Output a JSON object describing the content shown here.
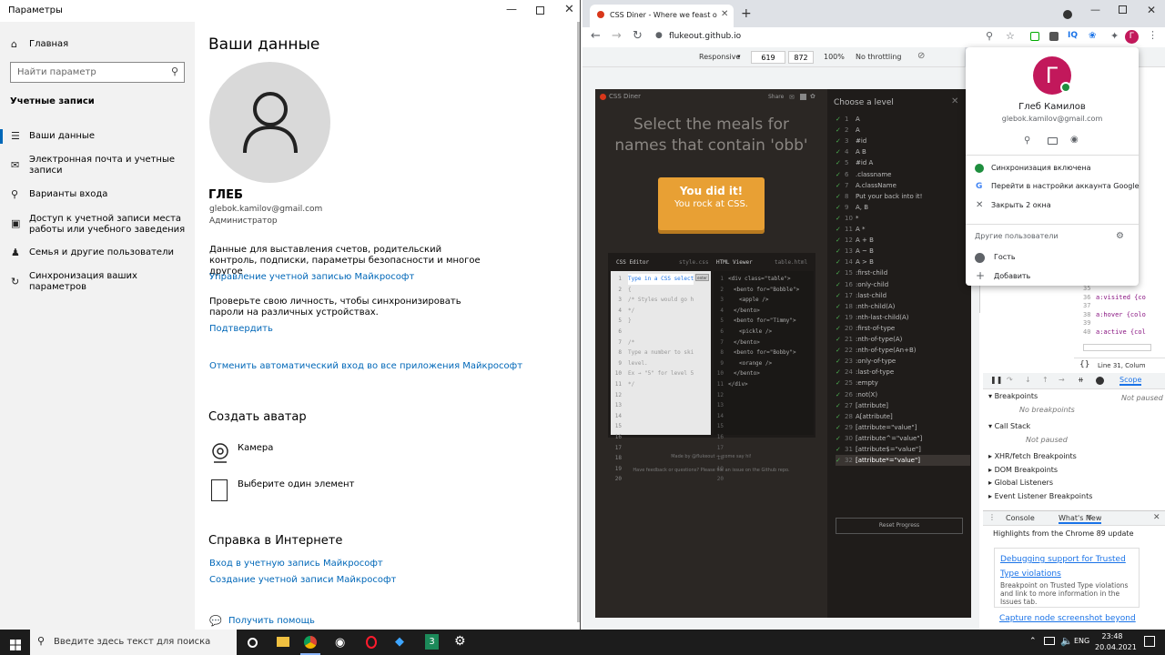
{
  "settings": {
    "window_title": "Параметры",
    "nav_home": "Главная",
    "search_placeholder": "Найти параметр",
    "section_title": "Учетные записи",
    "nav_items": [
      "Ваши данные",
      "Электронная почта и учетные записи",
      "Варианты входа",
      "Доступ к учетной записи места работы или учебного заведения",
      "Семья и другие пользователи",
      "Синхронизация ваших параметров"
    ],
    "page_title": "Ваши данные",
    "user_name": "ГЛЕБ",
    "user_email": "glebok.kamilov@gmail.com",
    "user_role": "Администратор",
    "billing_text": "Данные для выставления счетов, родительский контроль, подписки, параметры безопасности и многое другое",
    "manage_link": "Управление учетной записью Майкрософт",
    "verify_text": "Проверьте свою личность, чтобы синхронизировать пароли на различных устройствах.",
    "verify_link": "Подтвердить",
    "auto_signin_link": "Отменить автоматический вход во все приложения Майкрософт",
    "avatar_title": "Создать аватар",
    "camera_label": "Камера",
    "choose_label": "Выберите один элемент",
    "help_title": "Справка в Интернете",
    "help_link1": "Вход в учетную запись Майкрософт",
    "help_link2": "Создание учетной записи Майкрософт",
    "help_more": "Получить помощь"
  },
  "browser": {
    "tab_title": "CSS Diner - Where we feast on C",
    "url": "flukeout.github.io",
    "device": "Responsive",
    "width": "619",
    "height": "872",
    "zoom": "100%",
    "throttling": "No throttling"
  },
  "diner": {
    "logo": "CSS Diner",
    "share": "Share",
    "title_line1": "Select the meals for",
    "title_line2": "names that contain 'obb'",
    "done1": "You did it!",
    "done2": "You rock at CSS.",
    "editor_title": "CSS Editor",
    "editor_file": "style.css",
    "viewer_title": "HTML Viewer",
    "viewer_file": "table.html",
    "enter_btn": "enter",
    "css_lines": [
      "Type in a CSS selecto",
      "{",
      "/* Styles would go here.",
      "*/",
      "}",
      "",
      "/*",
      "Type a number to skip to a",
      "level.",
      "Ex → \"5\" for level 5",
      "*/"
    ],
    "html_lines": [
      "<div class=\"table\">",
      "<bento for=\"Bobble\">",
      "<apple />",
      "</bento>",
      "<bento for=\"Timmy\">",
      "<pickle />",
      "</bento>",
      "<bento for=\"Bobby\">",
      "<orange />",
      "</bento>",
      "</div>"
    ],
    "footer1": "Made by @flukeout — come say hi!",
    "footer2": "Have feedback or questions? Please file an issue on the Github repo.",
    "levels_title": "Choose a level",
    "levels": [
      "A",
      "A",
      "#id",
      "A B",
      "#id A",
      ".classname",
      "A.className",
      "Put your back into it!",
      "A, B",
      "*",
      "A *",
      "A + B",
      "A ~ B",
      "A > B",
      ":first-child",
      ":only-child",
      ":last-child",
      ":nth-child(A)",
      ":nth-last-child(A)",
      ":first-of-type",
      ":nth-of-type(A)",
      ":nth-of-type(An+B)",
      ":only-of-type",
      ":last-of-type",
      ":empty",
      ":not(X)",
      "[attribute]",
      "A[attribute]",
      "[attribute=\"value\"]",
      "[attribute^=\"value\"]",
      "[attribute$=\"value\"]",
      "[attribute*=\"value\"]"
    ],
    "reset": "Reset Progress"
  },
  "profile": {
    "initial": "Г",
    "name": "Глеб Камилов",
    "email": "glebok.kamilov@gmail.com",
    "sync": "Синхронизация включена",
    "google_account": "Перейти в настройки аккаунта Google",
    "close_windows": "Закрыть 2 окна",
    "other_users": "Другие пользователи",
    "guest": "Гость",
    "add": "Добавить"
  },
  "devtools": {
    "code_lines": [
      {
        "n": "35",
        "t": ""
      },
      {
        "n": "36",
        "t": "a:visited {co"
      },
      {
        "n": "37",
        "t": ""
      },
      {
        "n": "38",
        "t": "a:hover {colo"
      },
      {
        "n": "39",
        "t": ""
      },
      {
        "n": "40",
        "t": "a:active {col"
      }
    ],
    "status": "Line 31, Colum",
    "scope_tab": "Scope",
    "not_paused": "Not paused",
    "breakpoints": "Breakpoints",
    "no_breakpoints": "No breakpoints",
    "call_stack": "Call Stack",
    "not_paused2": "Not paused",
    "xhr": "XHR/fetch Breakpoints",
    "dom": "DOM Breakpoints",
    "global": "Global Listeners",
    "event": "Event Listener Breakpoints",
    "console_tab": "Console",
    "whats_new_tab": "What's New",
    "highlights": "Highlights from the Chrome 89 update",
    "news1_title": "Debugging support for Trusted Type violations",
    "news1_body": "Breakpoint on Trusted Type violations and link to more information in the Issues tab.",
    "news2_title": "Capture node screenshot beyond"
  },
  "taskbar": {
    "search": "Введите здесь текст для поиска",
    "lang": "ENG",
    "time": "23:48",
    "date": "20.04.2021"
  }
}
